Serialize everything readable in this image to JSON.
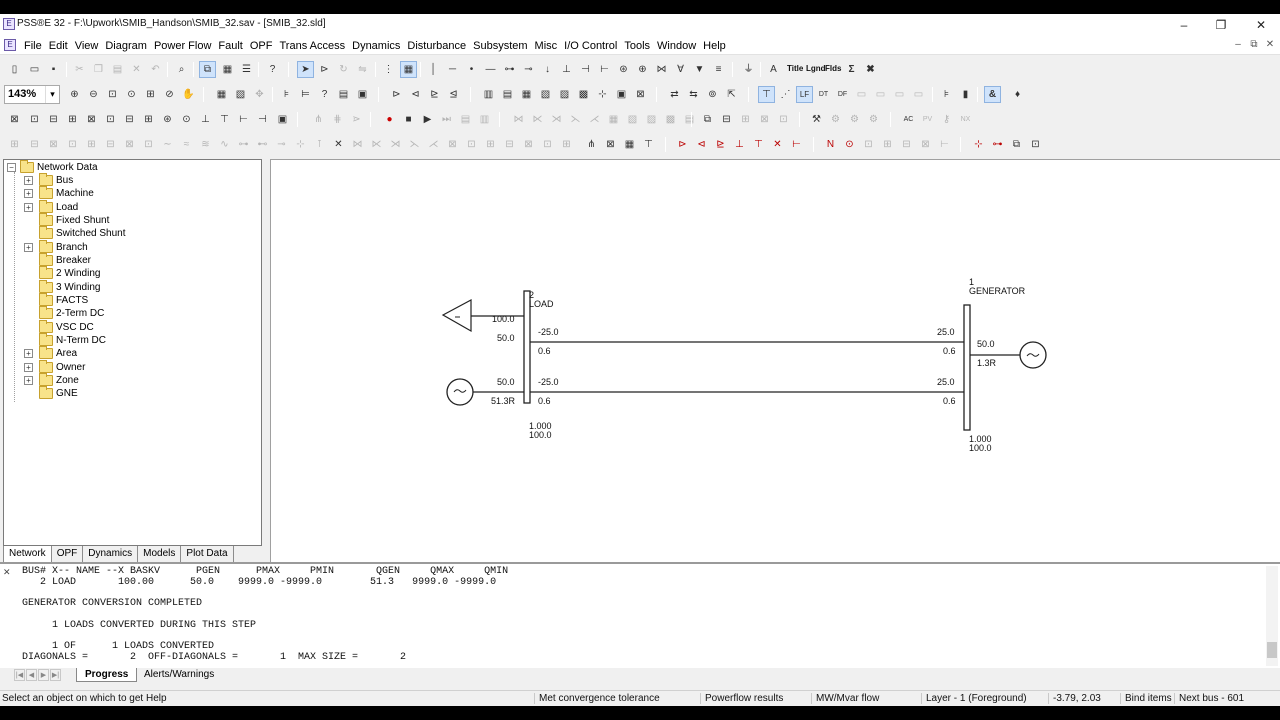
{
  "window": {
    "title": "PSS®E 32 - F:\\Upwork\\SMIB_Handson\\SMIB_32.sav - [SMIB_32.sld]",
    "app_icon": "E",
    "controls": [
      "–",
      "❐",
      "✕"
    ],
    "mdi_controls": [
      "–",
      "⧉",
      "✕"
    ]
  },
  "menu": [
    "File",
    "Edit",
    "View",
    "Diagram",
    "Power Flow",
    "Fault",
    "OPF",
    "Trans Access",
    "Dynamics",
    "Disturbance",
    "Subsystem",
    "Misc",
    "I/O Control",
    "Tools",
    "Window",
    "Help"
  ],
  "toolbar": {
    "zoom": "143%",
    "text_buttons": [
      "Title",
      "Lgnd",
      "Flds"
    ]
  },
  "tree": {
    "root": "Network Data",
    "items": [
      {
        "label": "Bus",
        "expandable": true
      },
      {
        "label": "Machine",
        "expandable": true
      },
      {
        "label": "Load",
        "expandable": true
      },
      {
        "label": "Fixed Shunt",
        "expandable": false
      },
      {
        "label": "Switched Shunt",
        "expandable": false
      },
      {
        "label": "Branch",
        "expandable": true
      },
      {
        "label": "Breaker",
        "expandable": false
      },
      {
        "label": "2 Winding",
        "expandable": false
      },
      {
        "label": "3 Winding",
        "expandable": false
      },
      {
        "label": "FACTS",
        "expandable": false
      },
      {
        "label": "2-Term DC",
        "expandable": false
      },
      {
        "label": "VSC DC",
        "expandable": false
      },
      {
        "label": "N-Term DC",
        "expandable": false
      },
      {
        "label": "Area",
        "expandable": true
      },
      {
        "label": "Owner",
        "expandable": true
      },
      {
        "label": "Zone",
        "expandable": true
      },
      {
        "label": "GNE",
        "expandable": false
      }
    ],
    "tabs": [
      "Network",
      "OPF",
      "Dynamics",
      "Models",
      "Plot Data"
    ],
    "active_tab": "Network"
  },
  "diagram": {
    "bus2": {
      "number": "2",
      "name": "LOAD",
      "voltage": "1.000",
      "angle": "100.0"
    },
    "bus1": {
      "number": "1",
      "name": "GENERATOR",
      "voltage": "1.000",
      "angle": "100.0"
    },
    "load": {
      "p": "100.0",
      "q": "50.0"
    },
    "machine2": {
      "p": "50.0",
      "q": "51.3R"
    },
    "machine1": {
      "p": "50.0",
      "q": "1.3R"
    },
    "branch_top": {
      "from_p": "-25.0",
      "from_q": "0.6",
      "to_p": "25.0",
      "to_q": "0.6"
    },
    "branch_bottom": {
      "from_p": "-25.0",
      "from_q": "0.6",
      "to_p": "25.0",
      "to_q": "0.6"
    }
  },
  "output": {
    "lines": [
      "BUS# X-- NAME --X BASKV      PGEN      PMAX     PMIN       QGEN     QMAX     QMIN",
      "   2 LOAD       100.00      50.0    9999.0 -9999.0        51.3   9999.0 -9999.0",
      "",
      "GENERATOR CONVERSION COMPLETED",
      "",
      "     1 LOADS CONVERTED DURING THIS STEP",
      "",
      "     1 OF      1 LOADS CONVERTED",
      "DIAGONALS =       2  OFF-DIAGONALS =       1  MAX SIZE =       2"
    ],
    "tabs": [
      "Progress",
      "Alerts/Warnings"
    ],
    "active_tab": "Progress"
  },
  "status": {
    "help": "Select an object on which to get Help",
    "convergence": "Met convergence tolerance",
    "results": "Powerflow results",
    "flow": "MW/Mvar flow",
    "layer": "Layer - 1 (Foreground)",
    "coords": "-3.79, 2.03",
    "bind": "Bind items",
    "next_bus": "Next bus - 601"
  }
}
